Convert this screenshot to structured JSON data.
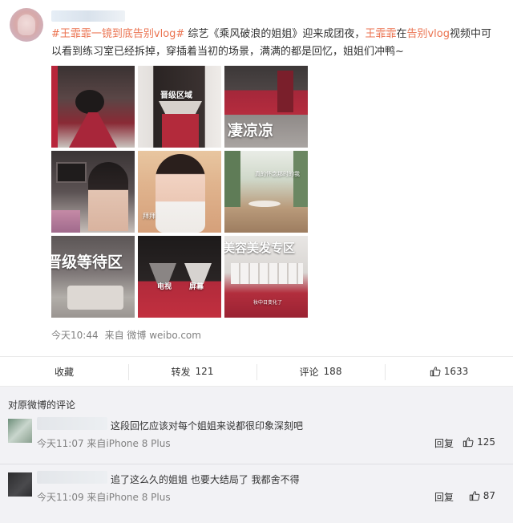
{
  "post": {
    "text_parts": {
      "tag": "#王霏霏一镜到底告别vlog#",
      "t1": " 综艺《乘风破浪的姐姐》迎来成团夜，",
      "name": "王霏霏",
      "t2": "在",
      "link": "告别vlog",
      "t3": "视频中可以看到练习室已经拆掉，穿插着当初的场景，满满的都是回忆，姐姐们冲鸭~"
    },
    "images": [
      {
        "caption": ""
      },
      {
        "caption": "晋级区域"
      },
      {
        "caption": "凄凉凉"
      },
      {
        "caption": ""
      },
      {
        "caption": "拜拜"
      },
      {
        "caption": "真的怀念那时的我"
      },
      {
        "caption": "晋级等待区"
      },
      {
        "caption_left": "电视",
        "caption_right": "屏幕"
      },
      {
        "caption": "美容美发专区",
        "sub": "妆中日变化了"
      }
    ],
    "time": "今天10:44",
    "source": "来自 微博 weibo.com"
  },
  "actions": {
    "favorite": "收藏",
    "repost_label": "转发",
    "repost_count": "121",
    "comment_label": "评论",
    "comment_count": "188",
    "like_count": "1633"
  },
  "comments": {
    "title": "对原微博的评论",
    "items": [
      {
        "text": "这段回忆应该对每个姐姐来说都很印象深刻吧",
        "time": "今天11:07 来自iPhone 8 Plus",
        "reply": "回复",
        "likes": "125"
      },
      {
        "text": "追了这么久的姐姐 也要大结局了 我都舍不得",
        "time": "今天11:09 来自iPhone 8 Plus",
        "reply": "回复",
        "likes": "87"
      }
    ]
  },
  "colors": {
    "accent": "#eb7350",
    "muted": "#808080",
    "comment_bg": "#f2f2f5"
  }
}
